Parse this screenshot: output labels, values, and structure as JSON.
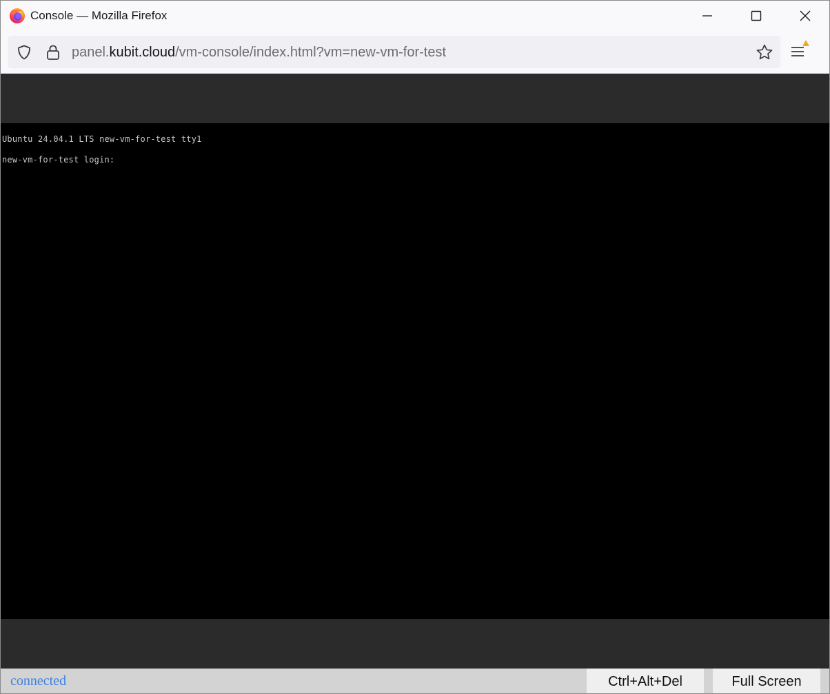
{
  "window": {
    "title": "Console — Mozilla Firefox",
    "app_icon": "firefox-icon"
  },
  "navbar": {
    "url_prefix": "panel.",
    "url_domain": "kubit.cloud",
    "url_path": "/vm-console/index.html?vm=new-vm-for-test",
    "icons": [
      "shield-icon",
      "lock-icon",
      "star-icon",
      "menu-icon"
    ]
  },
  "console": {
    "line1": "Ubuntu 24.04.1 LTS new-vm-for-test tty1",
    "line2": "new-vm-for-test login:"
  },
  "statusbar": {
    "status": "connected",
    "ctrl_alt_del_label": "Ctrl+Alt+Del",
    "fullscreen_label": "Full Screen"
  },
  "colors": {
    "console_bg": "#000000",
    "frame_bg": "#2b2b2b",
    "status_text": "#3f82e0",
    "statusbar_bg": "#d3d3d3",
    "menu_badge": "#f5a623"
  }
}
